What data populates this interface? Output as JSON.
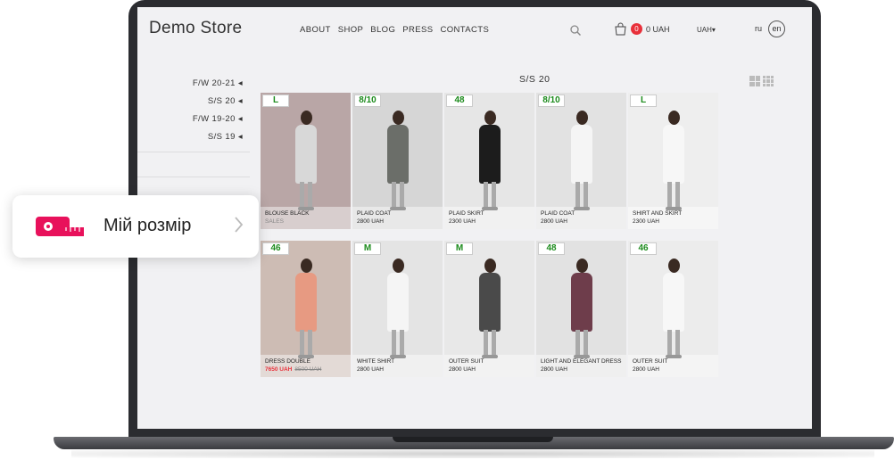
{
  "header": {
    "logo": "Demo Store",
    "nav": [
      "ABOUT",
      "SHOP",
      "BLOG",
      "PRESS",
      "CONTACTS"
    ],
    "cart_count": "0",
    "cart_total": "0 UAH",
    "currency": "UAH▾",
    "lang_ru": "ru",
    "lang_en": "en"
  },
  "sidebar": {
    "seasons": [
      "F/W 20-21 ◂",
      "S/S 20 ◂",
      "F/W 19-20 ◂",
      "S/S 19 ◂"
    ]
  },
  "section_title": "S/S 20",
  "products": [
    {
      "size": "L",
      "name": "BLOUSE BLACK",
      "price": "SALES",
      "bg": "#b9a6a6",
      "top": "#d8d8d8"
    },
    {
      "size": "8/10",
      "name": "PLAID COAT",
      "price": "2800 UAH",
      "bg": "#d6d6d6",
      "top": "#6b6e69"
    },
    {
      "size": "48",
      "name": "PLAID SKIRT",
      "price": "2300 UAH",
      "bg": "#e6e6e6",
      "top": "#1c1c1c"
    },
    {
      "size": "8/10",
      "name": "PLAID COAT",
      "price": "2800 UAH",
      "bg": "#e2e2e2",
      "top": "#f5f5f5"
    },
    {
      "size": "L",
      "name": "SHIRT AND SKIRT",
      "price": "2300 UAH",
      "bg": "#eeeeee",
      "top": "#f7f7f7"
    },
    {
      "size": "46",
      "name": "DRESS DOUBLE",
      "price": "7650 UAH",
      "old_price": "8500 UAH",
      "bg": "#cdbcb4",
      "top": "#e79a82"
    },
    {
      "size": "M",
      "name": "WHITE SHIRT",
      "price": "2800 UAH",
      "bg": "#e4e4e4",
      "top": "#f5f5f5"
    },
    {
      "size": "M",
      "name": "OUTER SUIT",
      "price": "2800 UAH",
      "bg": "#e8e8e8",
      "top": "#4a4a4a"
    },
    {
      "size": "48",
      "name": "LIGHT AND ELEGANT DRESS",
      "price": "2800 UAH",
      "bg": "#e2e2e2",
      "top": "#6e3d4b"
    },
    {
      "size": "46",
      "name": "OUTER SUIT",
      "price": "2800 UAH",
      "bg": "#ececec",
      "top": "#f7f7f7"
    }
  ],
  "widget": {
    "label": "Мій розмір",
    "accent": "#e8115b"
  }
}
